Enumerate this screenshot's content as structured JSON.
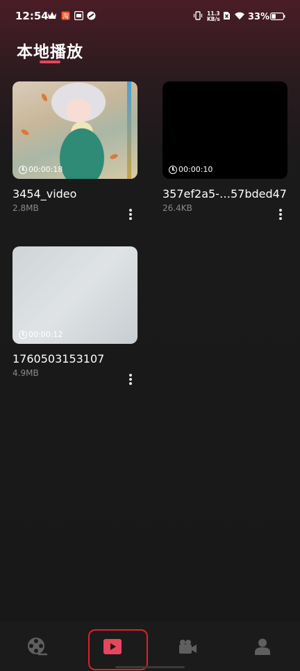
{
  "status_bar": {
    "time": "12:54",
    "network_speed_value": "11.3",
    "network_speed_unit": "KB/s",
    "battery_percent": "33%",
    "icons": [
      "crown-icon",
      "app-notification-icon",
      "app-notification-icon",
      "app-notification-icon",
      "vibrate-icon",
      "no-sim-icon",
      "wifi-icon",
      "battery-icon"
    ]
  },
  "header": {
    "title": "本地播放"
  },
  "videos": [
    {
      "name": "3454_video",
      "size": "2.8MB",
      "duration": "00:00:18",
      "thumbnail": "anime-illustration"
    },
    {
      "name": "357ef2a5-…57bded47",
      "size": "26.4KB",
      "duration": "00:00:10",
      "thumbnail": "black"
    },
    {
      "name": "1760503153107",
      "size": "4.9MB",
      "duration": "00:00:12",
      "thumbnail": "light-gray"
    }
  ],
  "bottom_nav": {
    "items": [
      {
        "icon": "film-reel-icon",
        "active": false
      },
      {
        "icon": "play-icon",
        "active": true
      },
      {
        "icon": "video-camera-icon",
        "active": false
      },
      {
        "icon": "person-icon",
        "active": false
      }
    ],
    "active_color": "#e8455f",
    "inactive_color": "#5f5f5f"
  },
  "colors": {
    "accent": "#e8455f",
    "background": "#181818",
    "highlight_border": "#e0202a"
  }
}
